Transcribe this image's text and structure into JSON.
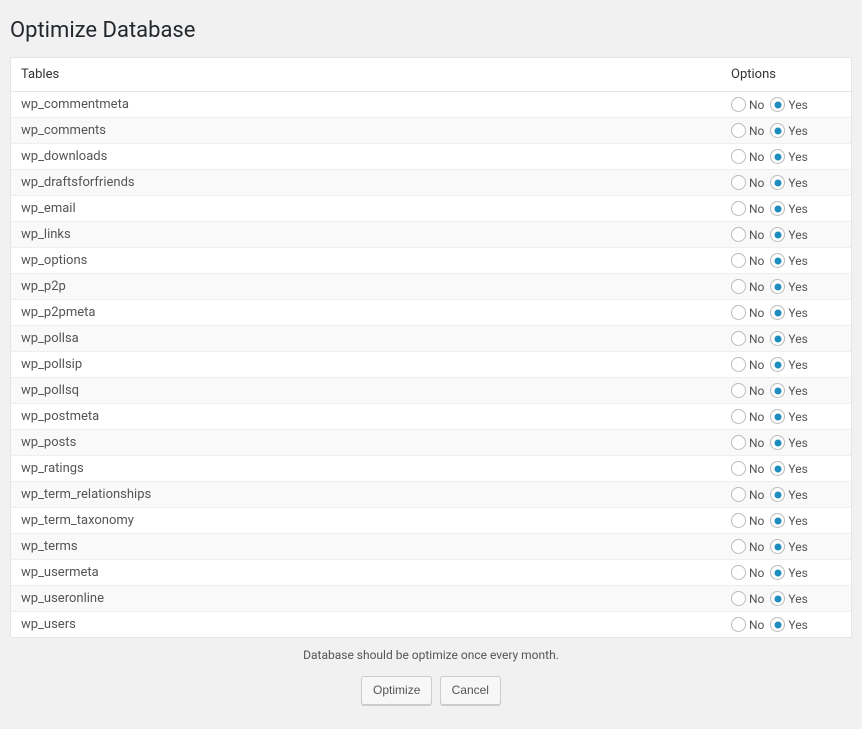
{
  "page": {
    "title": "Optimize Database"
  },
  "headers": {
    "tables": "Tables",
    "options": "Options"
  },
  "labels": {
    "no": "No",
    "yes": "Yes"
  },
  "tables": [
    {
      "name": "wp_commentmeta",
      "selected": "yes"
    },
    {
      "name": "wp_comments",
      "selected": "yes"
    },
    {
      "name": "wp_downloads",
      "selected": "yes"
    },
    {
      "name": "wp_draftsforfriends",
      "selected": "yes"
    },
    {
      "name": "wp_email",
      "selected": "yes"
    },
    {
      "name": "wp_links",
      "selected": "yes"
    },
    {
      "name": "wp_options",
      "selected": "yes"
    },
    {
      "name": "wp_p2p",
      "selected": "yes"
    },
    {
      "name": "wp_p2pmeta",
      "selected": "yes"
    },
    {
      "name": "wp_pollsa",
      "selected": "yes"
    },
    {
      "name": "wp_pollsip",
      "selected": "yes"
    },
    {
      "name": "wp_pollsq",
      "selected": "yes"
    },
    {
      "name": "wp_postmeta",
      "selected": "yes"
    },
    {
      "name": "wp_posts",
      "selected": "yes"
    },
    {
      "name": "wp_ratings",
      "selected": "yes"
    },
    {
      "name": "wp_term_relationships",
      "selected": "yes"
    },
    {
      "name": "wp_term_taxonomy",
      "selected": "yes"
    },
    {
      "name": "wp_terms",
      "selected": "yes"
    },
    {
      "name": "wp_usermeta",
      "selected": "yes"
    },
    {
      "name": "wp_useronline",
      "selected": "yes"
    },
    {
      "name": "wp_users",
      "selected": "yes"
    }
  ],
  "note": "Database should be optimize once every month.",
  "buttons": {
    "optimize": "Optimize",
    "cancel": "Cancel"
  }
}
